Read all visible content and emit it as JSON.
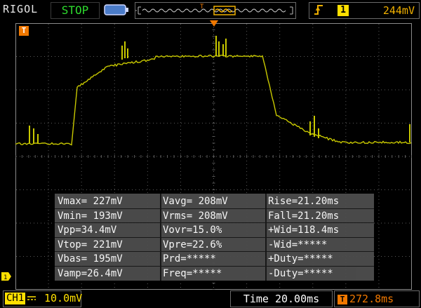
{
  "header": {
    "brand": "RIGOL",
    "run_state": "STOP",
    "trigger_type_icon": "rising-edge-icon",
    "trigger_source": "1",
    "trigger_level": "244mV"
  },
  "screen": {
    "trigger_position_label": "T",
    "channel_marker": "1"
  },
  "measurements": [
    [
      "Vmax= 227mV",
      "Vavg= 208mV",
      "Rise=21.20ms"
    ],
    [
      "Vmin= 193mV",
      "Vrms= 208mV",
      "Fall=21.20ms"
    ],
    [
      "Vpp=34.4mV",
      "Vovr=15.0%",
      "+Wid=118.4ms"
    ],
    [
      "Vtop= 221mV",
      "Vpre=22.6%",
      "-Wid=*****"
    ],
    [
      "Vbas= 195mV",
      "Prd=*****",
      "+Duty=*****"
    ],
    [
      "Vamp=26.4mV",
      "Freq=*****",
      "-Duty=*****"
    ]
  ],
  "footer": {
    "channel": "CH1",
    "channel_scale": "10.0mV",
    "timebase": "Time 20.00ms",
    "trigger_offset": "272.8ms",
    "trigger_offset_icon": "T"
  },
  "colors": {
    "trace": "#c8c800",
    "grid": "#5a5a5a",
    "accent_orange": "#f07800",
    "channel_yellow": "#ffe000",
    "status_green": "#2edc2e"
  }
}
